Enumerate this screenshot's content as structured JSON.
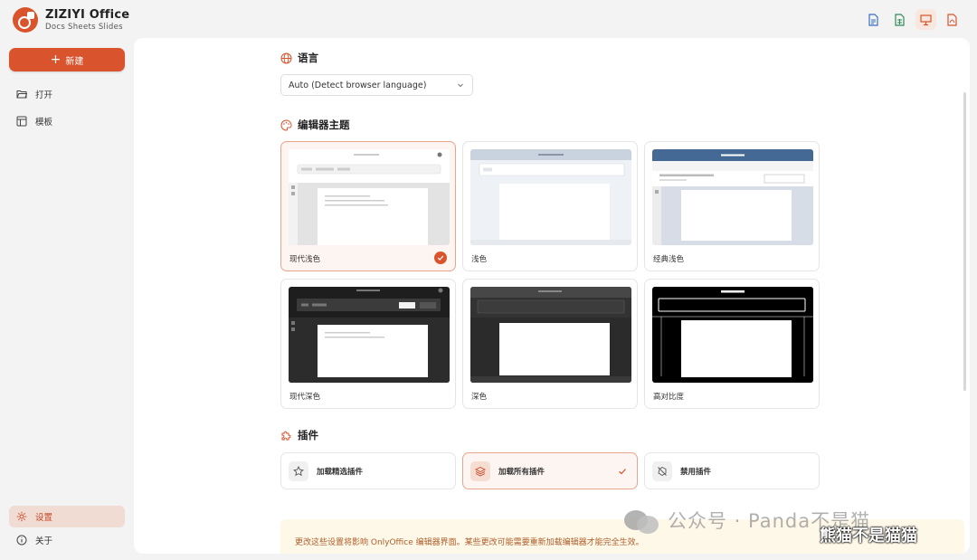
{
  "brand": {
    "name": "ZIZIYI Office",
    "subtitle": "Docs  Sheets  Slides"
  },
  "app_icons": [
    {
      "name": "docs-icon",
      "color": "#3a6fc4"
    },
    {
      "name": "sheets-icon",
      "color": "#2e8b57"
    },
    {
      "name": "slides-icon",
      "color": "#d9532c"
    },
    {
      "name": "pdf-icon",
      "color": "#d9532c"
    }
  ],
  "sidebar": {
    "new_label": "新建",
    "items": [
      {
        "label": "打开",
        "icon": "folder-open-icon"
      },
      {
        "label": "模板",
        "icon": "template-icon"
      }
    ],
    "bottom_items": [
      {
        "label": "设置",
        "icon": "gear-icon",
        "active": true
      },
      {
        "label": "关于",
        "icon": "info-icon"
      }
    ]
  },
  "language": {
    "title": "语言",
    "selected": "Auto (Detect browser language)"
  },
  "theme": {
    "title": "编辑器主题",
    "options": [
      {
        "label": "现代浅色",
        "selected": true
      },
      {
        "label": "浅色"
      },
      {
        "label": "经典浅色"
      },
      {
        "label": "现代深色"
      },
      {
        "label": "深色"
      },
      {
        "label": "高对比度"
      }
    ]
  },
  "plugins": {
    "title": "插件",
    "options": [
      {
        "label": "加载精选插件",
        "icon": "star-icon"
      },
      {
        "label": "加载所有插件",
        "icon": "layers-icon",
        "selected": true
      },
      {
        "label": "禁用插件",
        "icon": "disabled-plugin-icon"
      }
    ]
  },
  "notice": "更改这些设置将影响 OnlyOffice 编辑器界面。某些更改可能需要重新加载编辑器才能完全生效。",
  "watermark": {
    "text": "公众号 · Panda不是猫",
    "sub": "熊猫不是猫猫"
  },
  "colors": {
    "accent": "#d9532c",
    "accent_light": "#fdf5f1",
    "notice_bg": "#fdf8e8"
  }
}
